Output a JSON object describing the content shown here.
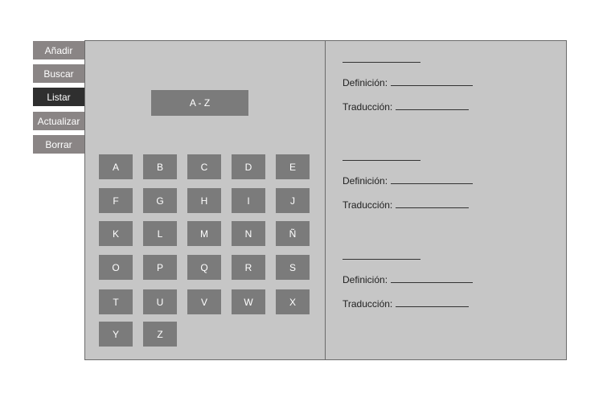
{
  "sidebar": {
    "items": [
      {
        "label": "Añadir"
      },
      {
        "label": "Buscar"
      },
      {
        "label": "Listar",
        "active": true
      },
      {
        "label": "Actualizar"
      },
      {
        "label": "Borrar"
      }
    ]
  },
  "main": {
    "sort_button_label": "A - Z",
    "letters": [
      "A",
      "B",
      "C",
      "D",
      "E",
      "F",
      "G",
      "H",
      "I",
      "J",
      "K",
      "L",
      "M",
      "N",
      "Ñ",
      "O",
      "P",
      "Q",
      "R",
      "S",
      "T",
      "U",
      "V",
      "W",
      "X",
      "Y",
      "Z"
    ]
  },
  "entries": [
    {
      "definition_label": "Definición:",
      "translation_label": "Traducción:"
    },
    {
      "definition_label": "Definición:",
      "translation_label": "Traducción:"
    },
    {
      "definition_label": "Definición:",
      "translation_label": "Traducción:"
    }
  ],
  "colors": {
    "panel_bg": "#c6c6c6",
    "button_bg": "#7b7b7b",
    "sidebar_bg": "#8a8585",
    "sidebar_active_bg": "#2f2f2f"
  }
}
